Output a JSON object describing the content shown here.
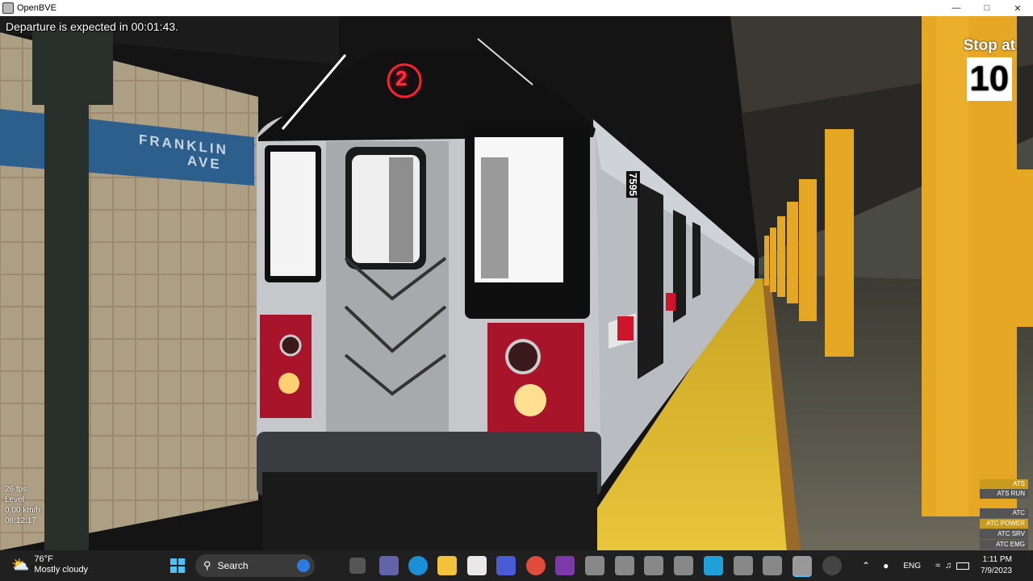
{
  "window": {
    "title": "OpenBVE"
  },
  "hud": {
    "departure": "Departure is expected in 00:01:43.",
    "stop_label": "Stop at",
    "stop_cars": "10",
    "fps": "26 fps",
    "grade": "Level",
    "speed": "0.00 km/h",
    "clock": "08:12:17"
  },
  "station": {
    "sign_line1": "FRANKLIN",
    "sign_line2": "AVE"
  },
  "train": {
    "route": "2",
    "car_number": "7595"
  },
  "safety": {
    "ats": "ATS",
    "ats_run": "ATS RUN",
    "atc": "ATC",
    "atc_power": "ATC POWER",
    "atc_srv": "ATC SRV",
    "atc_emg": "ATC EMG"
  },
  "taskbar": {
    "weather_temp": "76°F",
    "weather_desc": "Mostly cloudy",
    "search_placeholder": "Search",
    "lang": "ENG",
    "time": "1:11 PM",
    "date": "7/9/2023"
  },
  "colors": {
    "pillar": "#e6a724",
    "platform_edge": "#e8c53a",
    "route_badge": "#ff2030",
    "train_red": "#a8142a"
  }
}
